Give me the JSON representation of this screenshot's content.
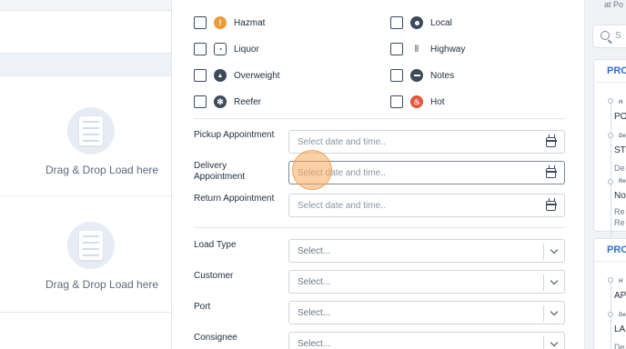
{
  "backdrop": {
    "drop_zones": [
      {
        "label": "Drag & Drop Load here"
      },
      {
        "label": "Drag & Drop Load here"
      }
    ],
    "right_top_text": "at Po",
    "search_placeholder": "S",
    "cards": [
      {
        "head": "PRO",
        "r1_small": "H",
        "r1_big": "PO",
        "r2_small": "De",
        "r2_big": "ST",
        "r3_mid": "De",
        "r4_small": "Re",
        "r4_big": "No",
        "r5_mid": "Re",
        "r6_mid": "Re"
      },
      {
        "head": "PRO",
        "r1_small": "H",
        "r1_big": "AP",
        "r2_small": "De",
        "r2_big": "LA",
        "r3_mid": "De"
      }
    ]
  },
  "filters": {
    "checkboxes": [
      {
        "label": "Hazmat",
        "icon": "hazmat-icon",
        "color": "#ec9a3a",
        "glyph": "!"
      },
      {
        "label": "Local",
        "icon": "local-icon",
        "color": "#3d4a5a",
        "glyph": "●"
      },
      {
        "label": "Liquor",
        "icon": "liquor-icon",
        "color": "#ffffff",
        "glyph": "⚗"
      },
      {
        "label": "Highway",
        "icon": "highway-icon",
        "color": "#ffffff",
        "glyph": "⦀"
      },
      {
        "label": "Overweight",
        "icon": "overweight-icon",
        "color": "#3d4a5a",
        "glyph": "▲"
      },
      {
        "label": "Notes",
        "icon": "notes-icon",
        "color": "#3d4a5a",
        "glyph": "≡"
      },
      {
        "label": "Reefer",
        "icon": "reefer-icon",
        "color": "#3d4a5a",
        "glyph": "✻"
      },
      {
        "label": "Hot",
        "icon": "hot-icon",
        "color": "#e8533c",
        "glyph": "♨"
      }
    ],
    "appointments": [
      {
        "label": "Pickup Appointment",
        "placeholder": "Select date and time.."
      },
      {
        "label": "Delivery Appointment",
        "placeholder": "Select date and time.."
      },
      {
        "label": "Return Appointment",
        "placeholder": "Select date and time.."
      }
    ],
    "selects": [
      {
        "label": "Load Type",
        "value": "Select..."
      },
      {
        "label": "Customer",
        "value": "Select..."
      },
      {
        "label": "Port",
        "value": "Select..."
      },
      {
        "label": "Consignee",
        "value": "Select..."
      }
    ]
  }
}
